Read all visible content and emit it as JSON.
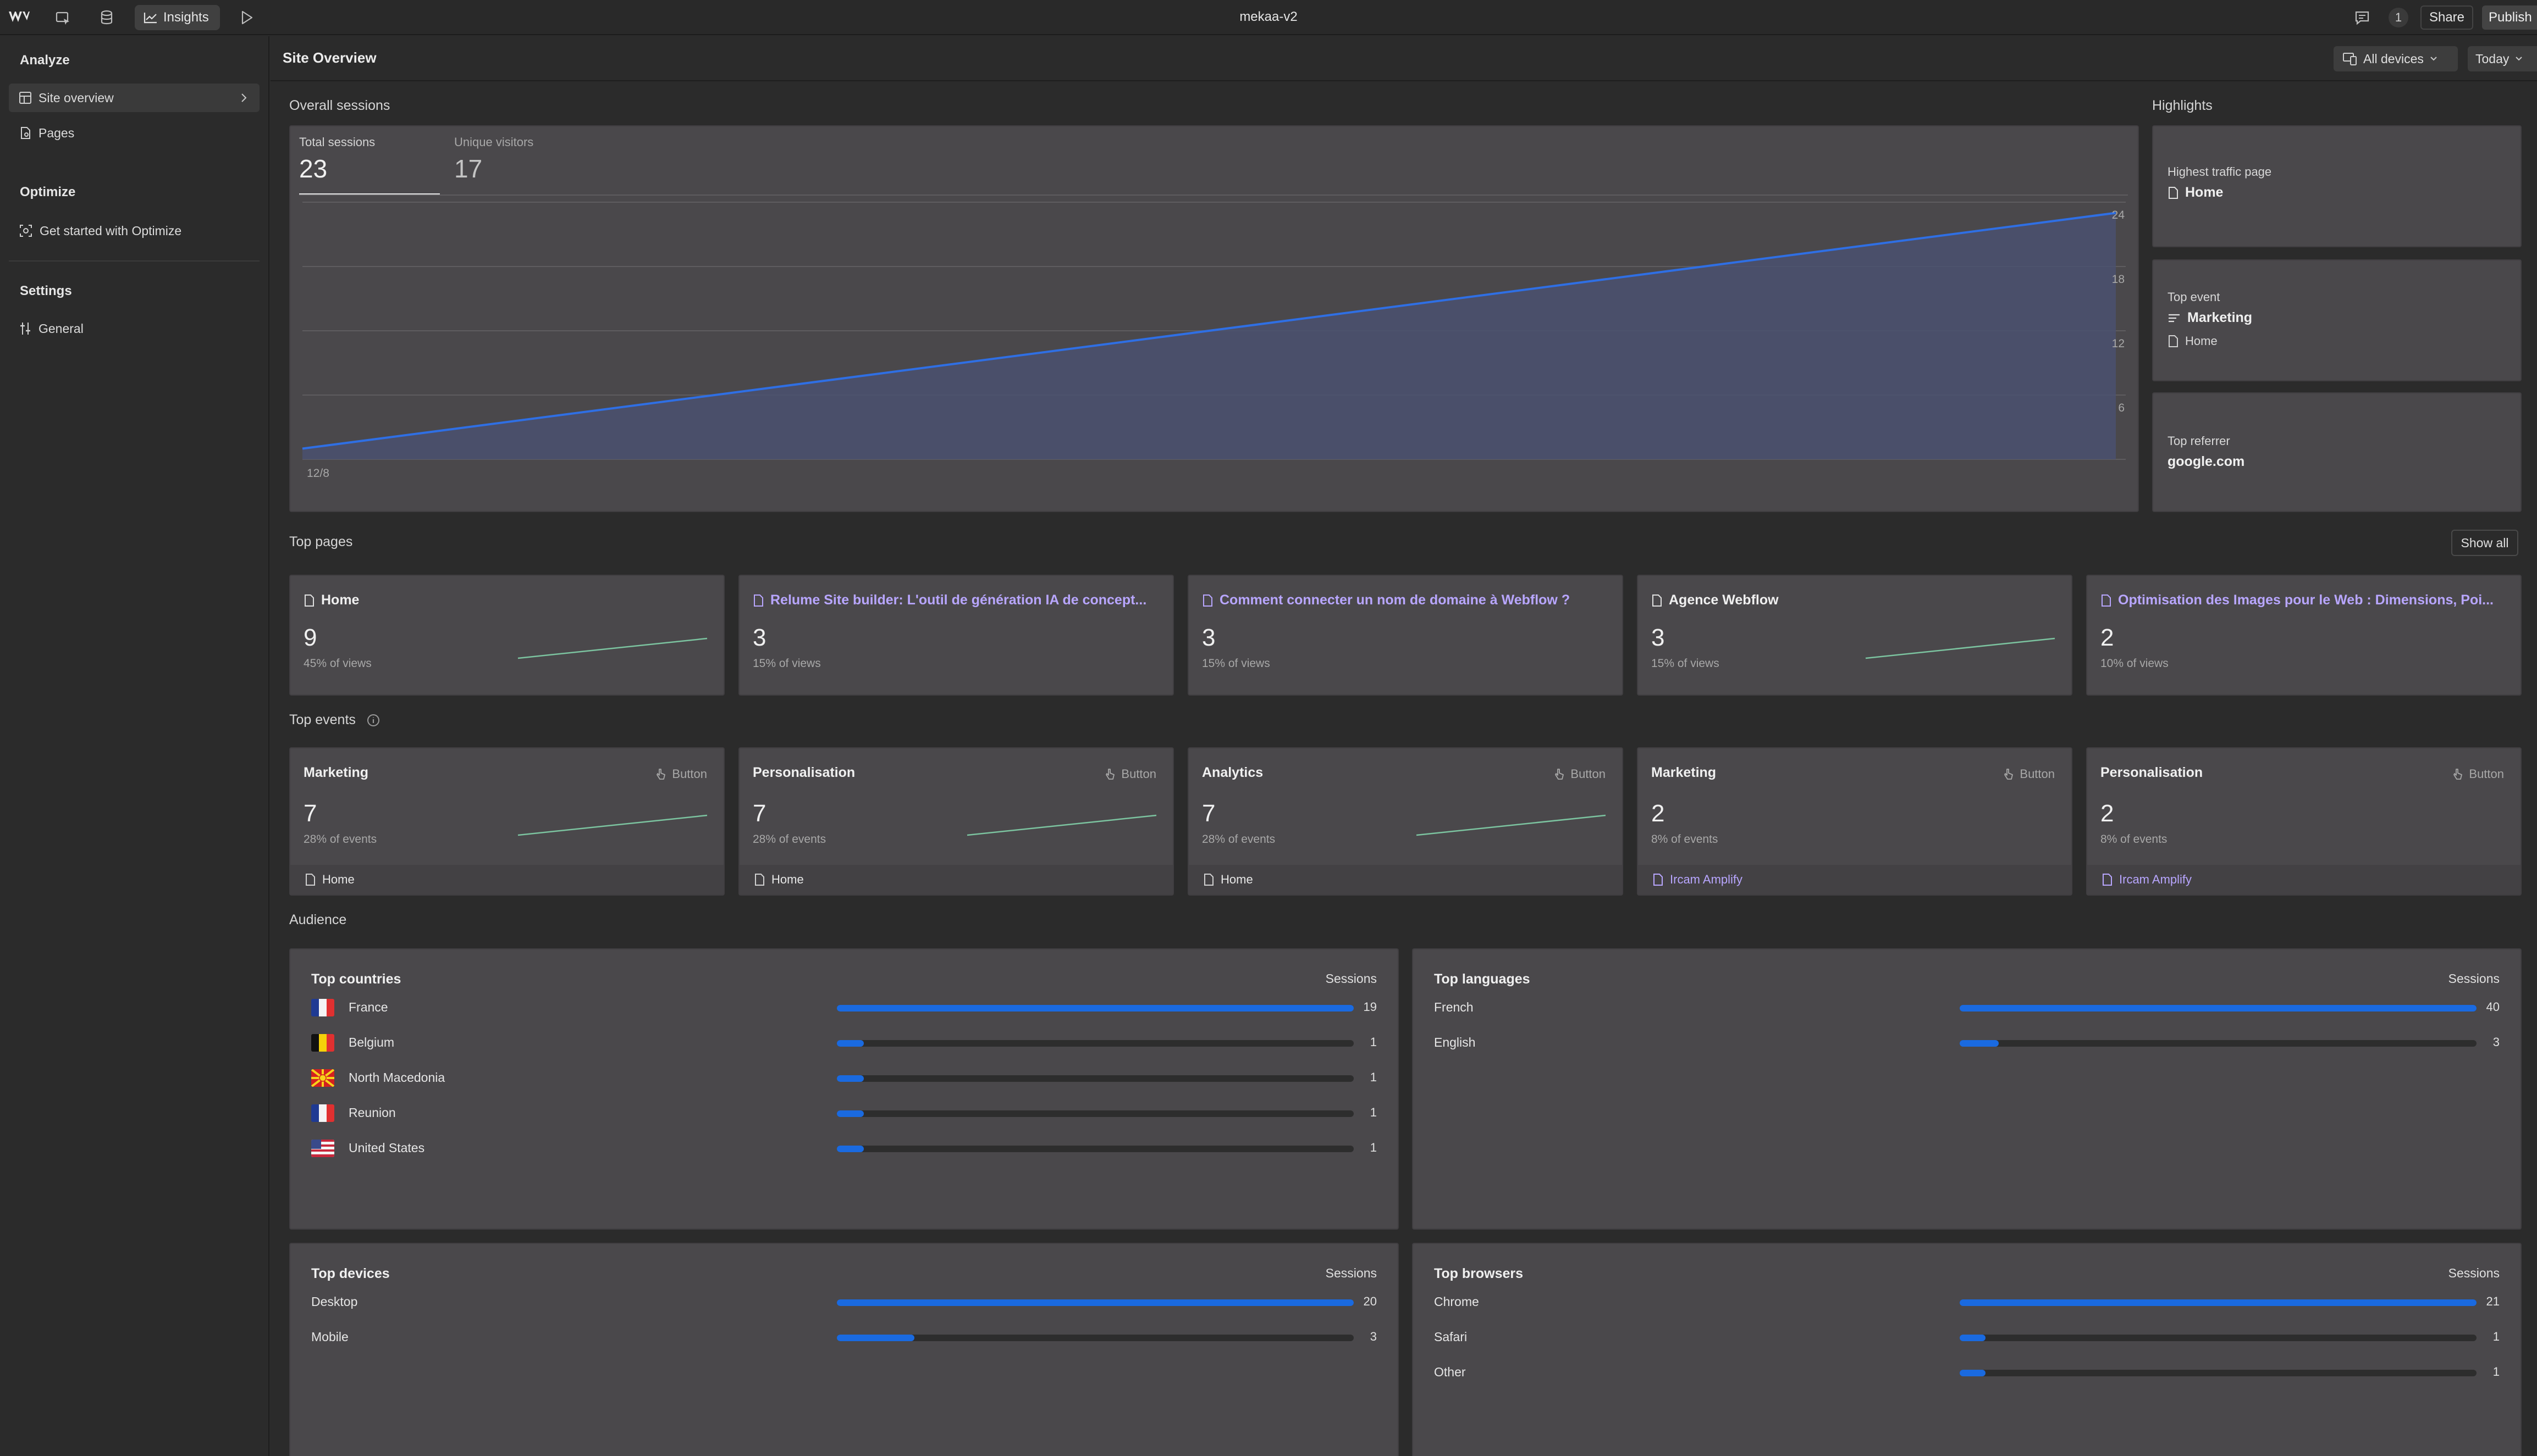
{
  "topbar": {
    "title": "mekaa-v2",
    "insights_label": "Insights",
    "comments_count": "1",
    "share_label": "Share",
    "publish_label": "Publish"
  },
  "sidebar": {
    "analyze_label": "Analyze",
    "analyze_items": [
      {
        "label": "Site overview",
        "icon": "layout-icon",
        "active": true
      },
      {
        "label": "Pages",
        "icon": "pages-icon"
      }
    ],
    "optimize_label": "Optimize",
    "optimize_items": [
      {
        "label": "Get started with Optimize",
        "icon": "optimize-icon"
      }
    ],
    "settings_label": "Settings",
    "settings_items": [
      {
        "label": "General",
        "icon": "sliders-icon"
      }
    ]
  },
  "header": {
    "title": "Site Overview",
    "devices_label": "All devices",
    "range_label": "Today"
  },
  "overall": {
    "heading": "Overall sessions",
    "tabs": [
      {
        "label": "Total sessions",
        "value": "23"
      },
      {
        "label": "Unique visitors",
        "value": "17"
      }
    ]
  },
  "chart_data": {
    "type": "area",
    "x": [
      "12/8"
    ],
    "series": [
      {
        "values": [
          1,
          23
        ]
      }
    ],
    "ylim": [
      0,
      24
    ],
    "yticks": [
      "24",
      "18",
      "12",
      "6"
    ],
    "xtick": "12/8",
    "line_color": "#2f6fe4",
    "fill_color": "#4a5170",
    "grid": true
  },
  "highlights": {
    "heading": "Highlights",
    "highest_traffic_label": "Highest traffic page",
    "highest_traffic_value": "Home",
    "top_event_label": "Top event",
    "top_event_value": "Marketing",
    "top_event_page": "Home",
    "top_referrer_label": "Top referrer",
    "top_referrer_value": "google.com"
  },
  "top_pages": {
    "heading": "Top pages",
    "show_all_label": "Show all",
    "items": [
      {
        "title": "Home",
        "value": "9",
        "pct": "45% of views",
        "link": false,
        "spark": true
      },
      {
        "title": "Relume Site builder: L'outil de génération IA de concept...",
        "value": "3",
        "pct": "15% of views",
        "link": true,
        "spark": false
      },
      {
        "title": "Comment connecter un nom de domaine à Webflow ?",
        "value": "3",
        "pct": "15% of views",
        "link": true,
        "spark": false
      },
      {
        "title": "Agence Webflow",
        "value": "3",
        "pct": "15% of views",
        "link": false,
        "spark": true
      },
      {
        "title": "Optimisation des Images pour le Web : Dimensions, Poi...",
        "value": "2",
        "pct": "10% of views",
        "link": true,
        "spark": false
      }
    ]
  },
  "top_events": {
    "heading": "Top events",
    "items": [
      {
        "title": "Marketing",
        "type": "Button",
        "value": "7",
        "pct": "28% of events",
        "page": "Home",
        "page_link": false,
        "spark": true
      },
      {
        "title": "Personalisation",
        "type": "Button",
        "value": "7",
        "pct": "28% of events",
        "page": "Home",
        "page_link": false,
        "spark": true
      },
      {
        "title": "Analytics",
        "type": "Button",
        "value": "7",
        "pct": "28% of events",
        "page": "Home",
        "page_link": false,
        "spark": true
      },
      {
        "title": "Marketing",
        "type": "Button",
        "value": "2",
        "pct": "8% of events",
        "page": "Ircam Amplify",
        "page_link": true,
        "spark": false
      },
      {
        "title": "Personalisation",
        "type": "Button",
        "value": "2",
        "pct": "8% of events",
        "page": "Ircam Amplify",
        "page_link": true,
        "spark": false
      }
    ]
  },
  "audience": {
    "heading": "Audience",
    "sessions_label": "Sessions",
    "countries": {
      "title": "Top countries",
      "rows": [
        {
          "name": "France",
          "value": 19,
          "flag": "fr"
        },
        {
          "name": "Belgium",
          "value": 1,
          "flag": "be"
        },
        {
          "name": "North Macedonia",
          "value": 1,
          "flag": "mk"
        },
        {
          "name": "Reunion",
          "value": 1,
          "flag": "fr"
        },
        {
          "name": "United States",
          "value": 1,
          "flag": "us"
        }
      ]
    },
    "languages": {
      "title": "Top languages",
      "rows": [
        {
          "name": "French",
          "value": 40
        },
        {
          "name": "English",
          "value": 3
        }
      ]
    },
    "devices": {
      "title": "Top devices",
      "rows": [
        {
          "name": "Desktop",
          "value": 20
        },
        {
          "name": "Mobile",
          "value": 3
        }
      ]
    },
    "browsers": {
      "title": "Top browsers",
      "rows": [
        {
          "name": "Chrome",
          "value": 21
        },
        {
          "name": "Safari",
          "value": 1
        },
        {
          "name": "Other",
          "value": 1
        }
      ]
    }
  }
}
